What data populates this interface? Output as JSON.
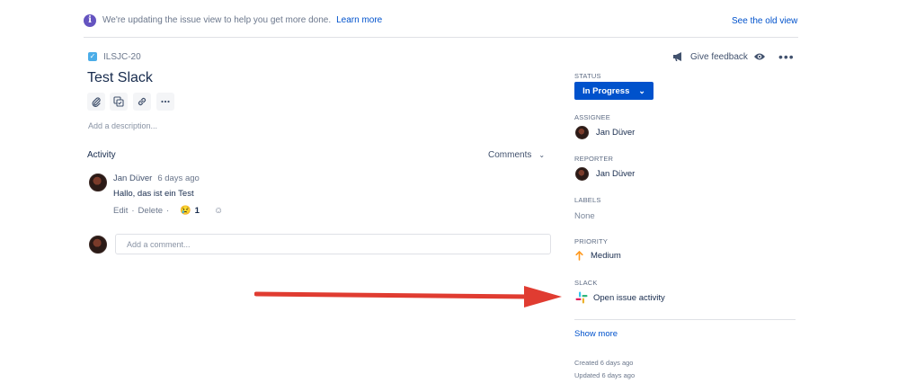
{
  "banner": {
    "info_icon": "info-icon",
    "text": "We're updating the issue view to help you get more done.",
    "learn_more": "Learn more",
    "old_view": "See the old view"
  },
  "issue": {
    "key": "ILSJC-20",
    "title": "Test Slack",
    "description_placeholder": "Add a description..."
  },
  "toolbar": {
    "icons": [
      "attachment-icon",
      "subtask-icon",
      "link-icon",
      "more-icon"
    ]
  },
  "activity": {
    "label": "Activity",
    "filter_label": "Comments",
    "comment": {
      "author": "Jan Düver",
      "time": "6 days ago",
      "body": "Hallo, das ist ein Test",
      "edit": "Edit",
      "delete": "Delete",
      "reaction_count": "1"
    },
    "add_comment_placeholder": "Add a comment..."
  },
  "header_actions": {
    "feedback": "Give feedback"
  },
  "fields": {
    "status_label": "STATUS",
    "status_value": "In Progress",
    "assignee_label": "ASSIGNEE",
    "assignee_value": "Jan Düver",
    "reporter_label": "REPORTER",
    "reporter_value": "Jan Düver",
    "labels_label": "LABELS",
    "labels_value": "None",
    "priority_label": "PRIORITY",
    "priority_value": "Medium",
    "slack_label": "SLACK",
    "slack_value": "Open issue activity",
    "show_more": "Show more",
    "created": "Created 6 days ago",
    "updated": "Updated 6 days ago"
  },
  "colors": {
    "accent": "#0052cc",
    "banner_icon": "#6554c0",
    "priority_medium": "#ff991f",
    "annotation_arrow": "#e03c31"
  }
}
